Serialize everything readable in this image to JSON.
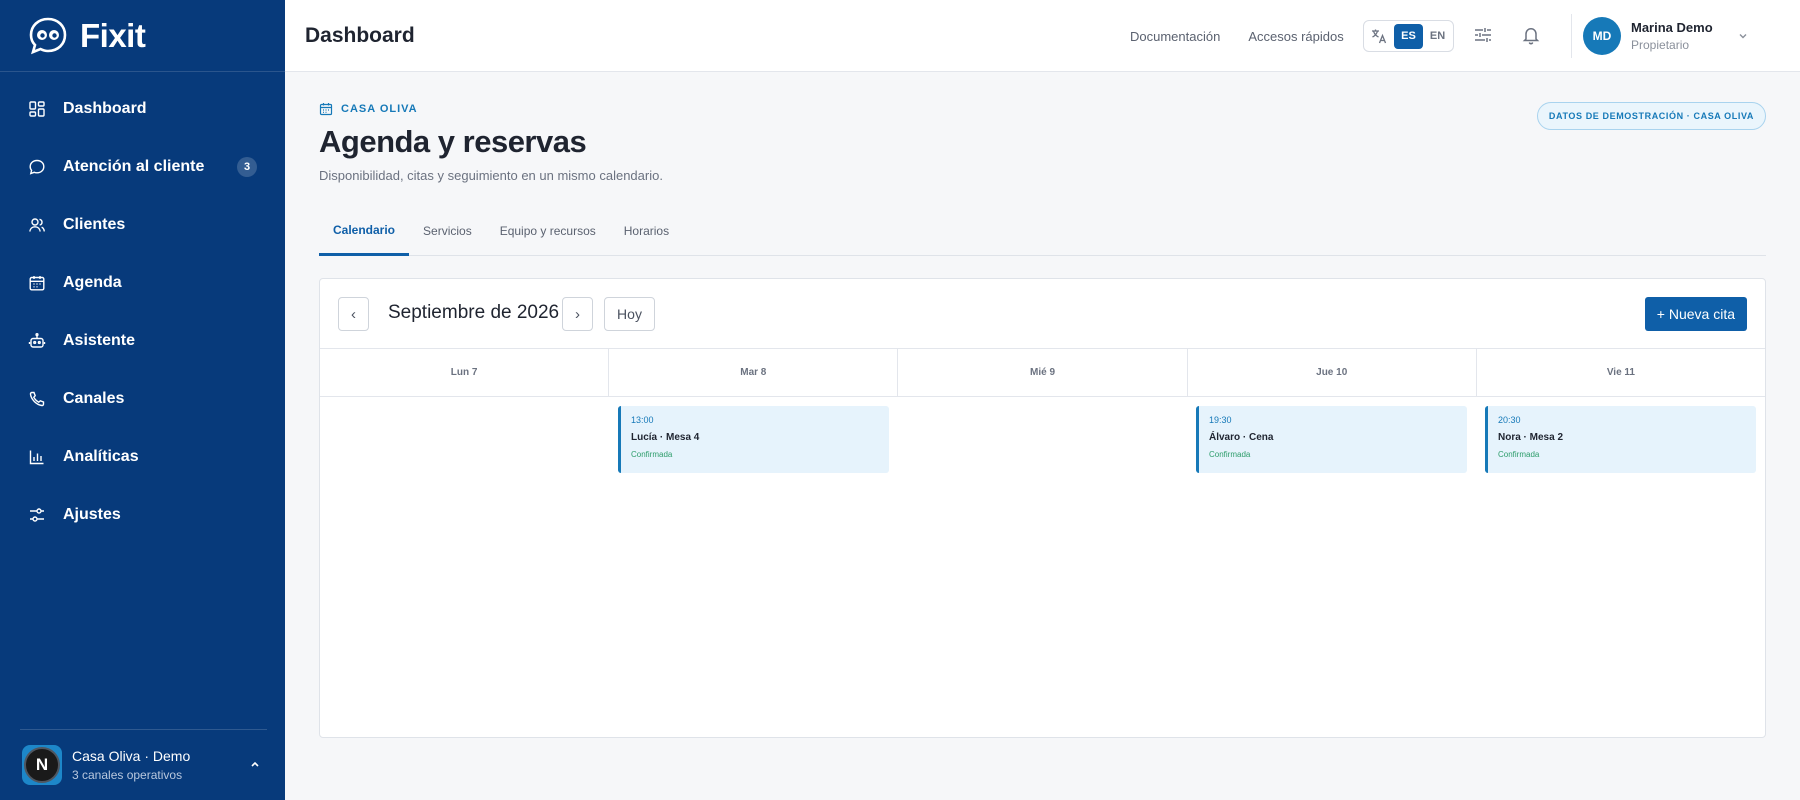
{
  "brand": {
    "name": "Fixit"
  },
  "sidebar": {
    "items": [
      {
        "label": "Dashboard",
        "icon": "dashboard-icon"
      },
      {
        "label": "Atención al cliente",
        "icon": "chat-bubble-icon",
        "badge": "3"
      },
      {
        "label": "Clientes",
        "icon": "users-icon"
      },
      {
        "label": "Agenda",
        "icon": "calendar-icon"
      },
      {
        "label": "Asistente",
        "icon": "robot-icon"
      },
      {
        "label": "Canales",
        "icon": "channels-icon"
      },
      {
        "label": "Analíticas",
        "icon": "bar-chart-icon"
      },
      {
        "label": "Ajustes",
        "icon": "sliders-icon"
      }
    ],
    "workspace": {
      "initial": "N",
      "name": "Casa Oliva · Demo",
      "subtitle": "3 canales operativos"
    }
  },
  "header": {
    "title": "Dashboard",
    "links": [
      "Documentación",
      "Accesos rápidos"
    ],
    "languages": [
      "ES",
      "EN"
    ],
    "active_language": "ES",
    "user": {
      "initials": "MD",
      "name": "Marina Demo",
      "role": "Propietario"
    }
  },
  "page": {
    "eyebrow": "CASA OLIVA",
    "title": "Agenda y reservas",
    "subtitle": "Disponibilidad, citas y seguimiento en un mismo calendario.",
    "badge": "DATOS DE DEMOSTRACIÓN · CASA OLIVA",
    "tabs": [
      "Calendario",
      "Servicios",
      "Equipo y recursos",
      "Horarios"
    ],
    "active_tab": "Calendario"
  },
  "calendar": {
    "prev": "‹",
    "next": "›",
    "month": "Septiembre de 2026",
    "today_label": "Hoy",
    "new_label": "+ Nueva cita",
    "days": [
      "Lun 7",
      "Mar 8",
      "Mié 9",
      "Jue 10",
      "Vie 11"
    ],
    "events": [
      {
        "day": "Mar 8",
        "time": "13:00",
        "title": "Lucía · Mesa 4",
        "status": "Confirmada"
      },
      {
        "day": "Jue 10",
        "time": "19:30",
        "title": "Álvaro · Cena",
        "status": "Confirmada"
      },
      {
        "day": "Vie 11",
        "time": "20:30",
        "title": "Nora · Mesa 2",
        "status": "Confirmada"
      }
    ]
  },
  "colors": {
    "sidebar": "#073a7b",
    "accent": "#0f5fa8",
    "event_bg": "#e6f3fc",
    "confirmed": "#2e9d6b"
  }
}
